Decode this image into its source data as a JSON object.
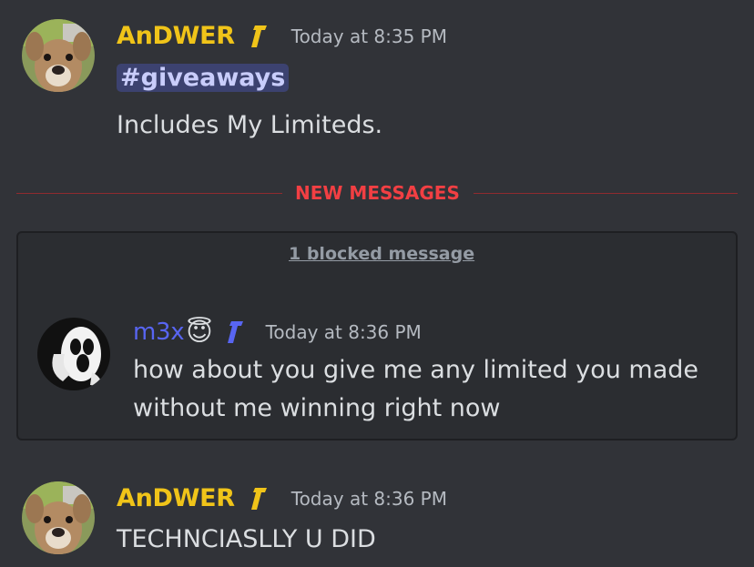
{
  "messages": [
    {
      "username": "AnDWER",
      "username_color": "#f0c419",
      "timestamp": "Today at 8:35 PM",
      "channel_mention": "#giveaways",
      "text": "Includes My Limiteds."
    },
    {
      "username": "m3x",
      "username_color": "#5865f2",
      "emoji": "😇",
      "timestamp": "Today at 8:36 PM",
      "lines": [
        "how about you give me any limited you made",
        "without me winning right now"
      ]
    },
    {
      "username": "AnDWER",
      "username_color": "#f0c419",
      "timestamp": "Today at 8:36 PM",
      "text": "TECHNCIASLLY U DID"
    }
  ],
  "divider": {
    "label": "NEW MESSAGES"
  },
  "blocked": {
    "link_text": "1 blocked message"
  },
  "icons": {
    "avatar_andwer": "deer-avatar",
    "avatar_m3x": "ghost-avatar",
    "role_badge": "role-icon"
  },
  "colors": {
    "background": "#313338",
    "new_messages": "#f23f43",
    "mention_bg": "#3c4270"
  }
}
